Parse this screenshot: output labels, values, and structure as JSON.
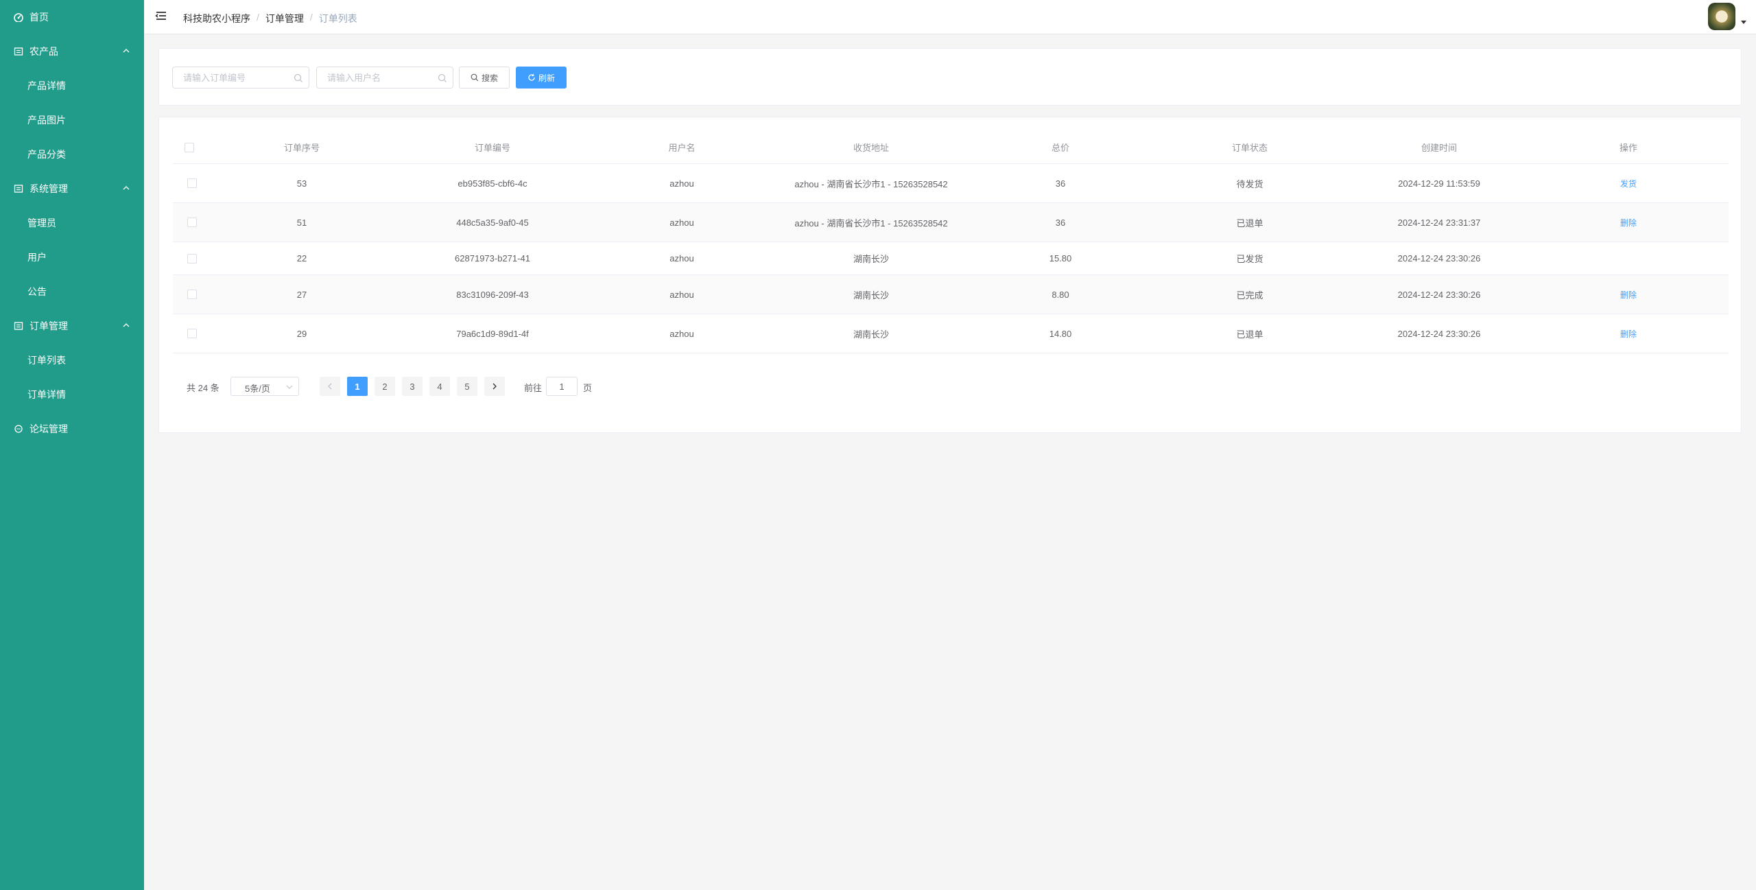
{
  "sidebar": {
    "items": [
      {
        "label": "首页",
        "level": "top",
        "icon": "dashboard-icon"
      },
      {
        "label": "农产品",
        "level": "top",
        "icon": "grid-icon",
        "expanded": true
      },
      {
        "label": "产品详情",
        "level": "sub"
      },
      {
        "label": "产品图片",
        "level": "sub"
      },
      {
        "label": "产品分类",
        "level": "sub"
      },
      {
        "label": "系统管理",
        "level": "top",
        "icon": "grid-icon",
        "expanded": true
      },
      {
        "label": "管理员",
        "level": "sub"
      },
      {
        "label": "用户",
        "level": "sub"
      },
      {
        "label": "公告",
        "level": "sub"
      },
      {
        "label": "订单管理",
        "level": "top",
        "icon": "grid-icon",
        "expanded": true
      },
      {
        "label": "订单列表",
        "level": "sub"
      },
      {
        "label": "订单详情",
        "level": "sub"
      },
      {
        "label": "论坛管理",
        "level": "top",
        "icon": "chat-icon"
      }
    ],
    "bg_color": "#229c8a"
  },
  "header": {
    "breadcrumb": [
      "科技助农小程序",
      "订单管理",
      "订单列表"
    ],
    "separator": "/"
  },
  "search": {
    "order_no_placeholder": "请输入订单编号",
    "username_placeholder": "请输入用户名",
    "search_label": "搜索",
    "refresh_label": "刷新"
  },
  "table": {
    "columns": [
      "订单序号",
      "订单编号",
      "用户名",
      "收货地址",
      "总价",
      "订单状态",
      "创建时间",
      "操作"
    ],
    "rows": [
      {
        "seq": "53",
        "order_no": "eb953f85-cbf6-4c",
        "username": "azhou",
        "address": "azhou - 湖南省长沙市1 - 15263528542",
        "total": "36",
        "status": "待发货",
        "created": "2024-12-29 11:53:59",
        "action": "发货"
      },
      {
        "seq": "51",
        "order_no": "448c5a35-9af0-45",
        "username": "azhou",
        "address": "azhou - 湖南省长沙市1 - 15263528542",
        "total": "36",
        "status": "已退单",
        "created": "2024-12-24 23:31:37",
        "action": "删除"
      },
      {
        "seq": "22",
        "order_no": "62871973-b271-41",
        "username": "azhou",
        "address": "湖南长沙",
        "total": "15.80",
        "status": "已发货",
        "created": "2024-12-24 23:30:26",
        "action": ""
      },
      {
        "seq": "27",
        "order_no": "83c31096-209f-43",
        "username": "azhou",
        "address": "湖南长沙",
        "total": "8.80",
        "status": "已完成",
        "created": "2024-12-24 23:30:26",
        "action": "删除"
      },
      {
        "seq": "29",
        "order_no": "79a6c1d9-89d1-4f",
        "username": "azhou",
        "address": "湖南长沙",
        "total": "14.80",
        "status": "已退单",
        "created": "2024-12-24 23:30:26",
        "action": "删除"
      }
    ]
  },
  "pagination": {
    "total_text": "共 24 条",
    "page_size": "5条/页",
    "pages": [
      "1",
      "2",
      "3",
      "4",
      "5"
    ],
    "current_page": "1",
    "goto_label": "前往",
    "goto_value": "1",
    "page_suffix": "页"
  },
  "colors": {
    "accent": "#409eff",
    "sidebar": "#229c8a"
  }
}
